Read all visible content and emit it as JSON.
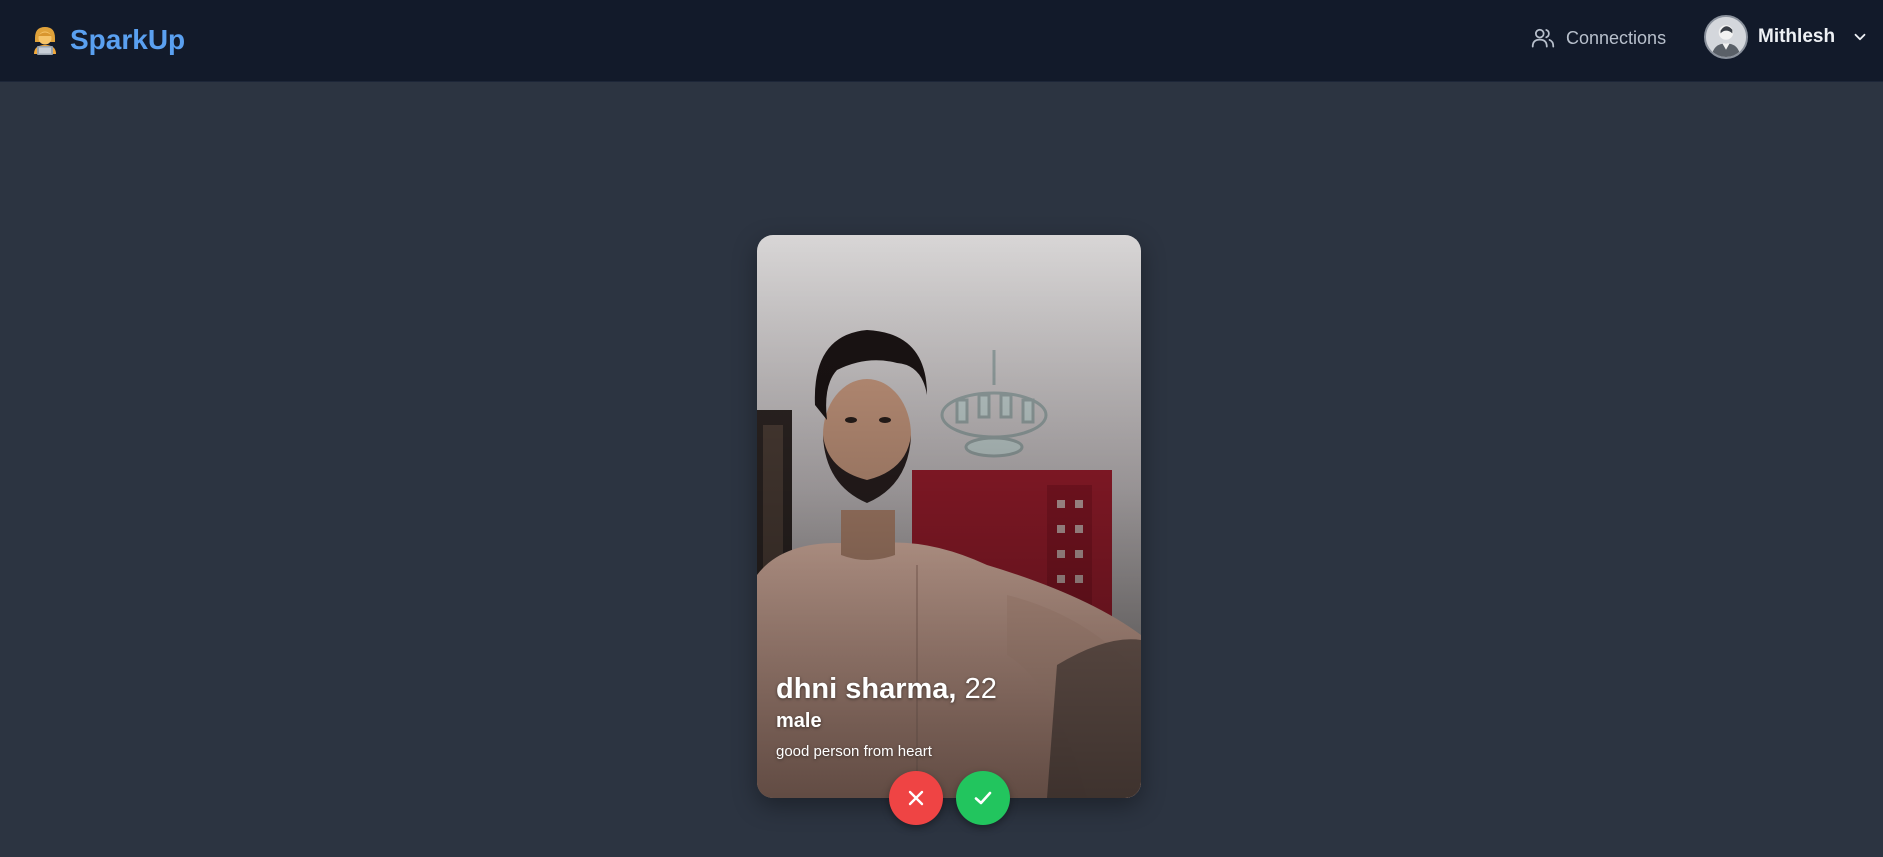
{
  "navbar": {
    "brand_name": "SparkUp",
    "brand_icon": "technologist-emoji",
    "connections_label": "Connections",
    "connections_icon": "users-icon",
    "user_name": "Mithlesh"
  },
  "card": {
    "name": "dhni sharma,",
    "age": "22",
    "gender": "male",
    "bio": "good person from heart"
  },
  "actions": {
    "reject_icon": "close-icon",
    "accept_icon": "check-icon"
  },
  "colors": {
    "background": "#2c3441",
    "navbar": "#121a2a",
    "brand": "#5aa0f0",
    "reject": "#ef4444",
    "accept": "#22c55e"
  }
}
